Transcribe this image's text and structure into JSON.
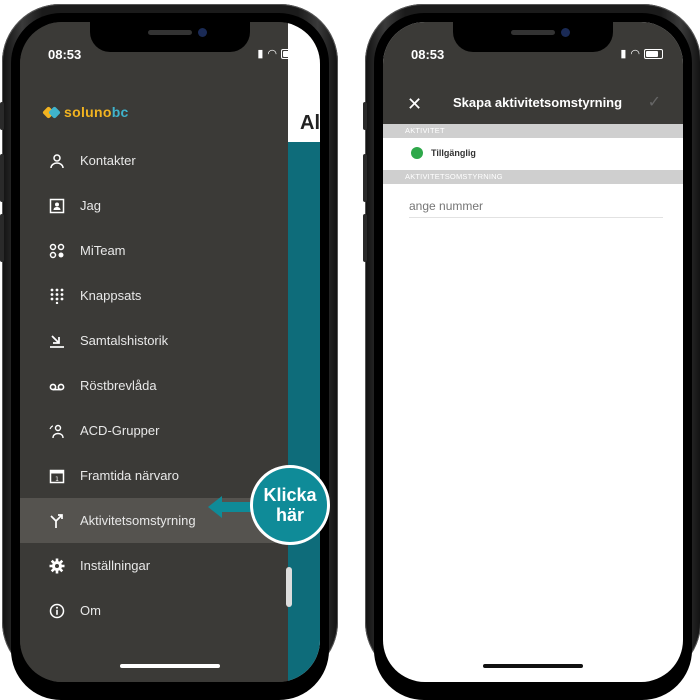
{
  "status": {
    "time": "08:53"
  },
  "left": {
    "logo": {
      "part1": "soluno",
      "part2": "bc"
    },
    "behind_title": "Al",
    "menu": [
      {
        "label": "Kontakter",
        "icon": "person-icon"
      },
      {
        "label": "Jag",
        "icon": "profile-card-icon"
      },
      {
        "label": "MiTeam",
        "icon": "team-icon"
      },
      {
        "label": "Knappsats",
        "icon": "keypad-icon"
      },
      {
        "label": "Samtalshistorik",
        "icon": "call-history-icon"
      },
      {
        "label": "Röstbrevlåda",
        "icon": "voicemail-icon"
      },
      {
        "label": "ACD-Grupper",
        "icon": "acd-group-icon"
      },
      {
        "label": "Framtida närvaro",
        "icon": "calendar-icon"
      },
      {
        "label": "Aktivitetsomstyrning",
        "icon": "call-forward-icon"
      },
      {
        "label": "Inställningar",
        "icon": "gear-icon"
      },
      {
        "label": "Om",
        "icon": "info-icon"
      }
    ],
    "active_index": 8,
    "callout": {
      "line1": "Klicka",
      "line2": "här"
    }
  },
  "right": {
    "header": {
      "title": "Skapa aktivitetsomstyrning",
      "close": "✕",
      "confirm": "✓"
    },
    "section_activity": "AKTIVITET",
    "status_label": "Tillgänglig",
    "section_forward": "AKTIVITETSOMSTYRNING",
    "number_placeholder": "ange nummer"
  },
  "colors": {
    "drawer_bg": "#3b3a37",
    "active_item_bg": "#55534f",
    "accent_teal": "#0f8b98",
    "available_green": "#2ea84a",
    "logo_yellow": "#f2b320",
    "logo_blue": "#3fb3cc"
  }
}
